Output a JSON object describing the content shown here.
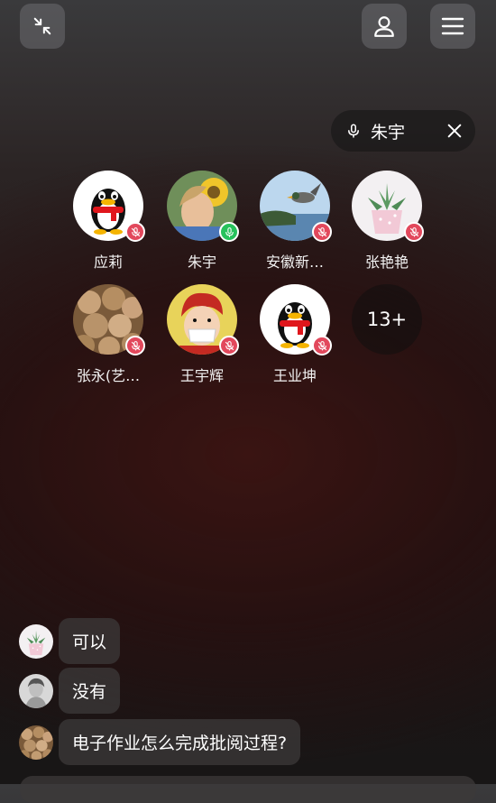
{
  "top": {
    "icons": [
      "minimize-icon",
      "profile-icon",
      "menu-icon"
    ]
  },
  "speaking": {
    "name": "朱宇",
    "icons": [
      "microphone-icon",
      "close-icon"
    ]
  },
  "members": [
    {
      "name": "应莉",
      "mic": "muted",
      "avatar": "penguin"
    },
    {
      "name": "朱宇",
      "mic": "on",
      "avatar": "child-sunflower"
    },
    {
      "name": "安徽新…",
      "mic": "muted",
      "avatar": "duck"
    },
    {
      "name": "张艳艳",
      "mic": "muted",
      "avatar": "succulent"
    },
    {
      "name": "张永(艺…",
      "mic": "muted",
      "avatar": "walnuts"
    },
    {
      "name": "王宇辉",
      "mic": "muted",
      "avatar": "cartoon-boy"
    },
    {
      "name": "王业坤",
      "mic": "muted",
      "avatar": "penguin"
    }
  ],
  "more_count": "13+",
  "chat": [
    {
      "text": "可以",
      "avatar": "succulent"
    },
    {
      "text": "没有",
      "avatar": "girl-photo"
    },
    {
      "text": "电子作业怎么完成批阅过程?",
      "avatar": "walnuts"
    }
  ],
  "colors": {
    "muted": "#e2485c",
    "on": "#27c25c"
  }
}
